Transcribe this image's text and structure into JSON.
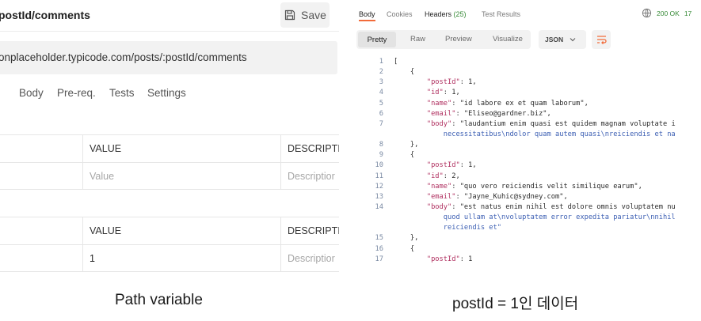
{
  "left_panel": {
    "request_title": "postId/comments",
    "save_label": "Save",
    "url": "onplaceholder.typicode.com/posts/:postId/comments",
    "tabs": [
      ")",
      "Body",
      "Pre-req.",
      "Tests",
      "Settings"
    ],
    "query_params_table": {
      "headers": [
        "",
        "VALUE",
        "DESCRIPTI"
      ],
      "rows": [
        [
          "",
          "Value",
          "Descriptior"
        ]
      ]
    },
    "path_variables_table": {
      "headers": [
        "",
        "VALUE",
        "DESCRIPTI"
      ],
      "rows": [
        [
          "",
          "1",
          "Descriptior"
        ]
      ]
    }
  },
  "right_panel": {
    "tabs": [
      "Body",
      "Cookies",
      "Headers",
      "Test Results"
    ],
    "headers_count": "(25)",
    "status": "200 OK",
    "time": "17",
    "format_tabs": [
      "Pretty",
      "Raw",
      "Preview",
      "Visualize"
    ],
    "format_select": "JSON",
    "line_numbers": [
      "1",
      "2",
      "3",
      "4",
      "5",
      "6",
      "7",
      "",
      "8",
      "9",
      "10",
      "11",
      "12",
      "13",
      "14",
      "",
      "",
      "15",
      "16",
      "17"
    ],
    "code_lines": [
      "[",
      "    {",
      "        \"postId\": 1,",
      "        \"id\": 1,",
      "        \"name\": \"id labore ex et quam laborum\",",
      "        \"email\": \"Eliseo@gardner.biz\",",
      "        \"body\": \"laudantium enim quasi est quidem magnam voluptate i",
      "            necessitatibus\\ndolor quam autem quasi\\nreiciendis et na",
      "    },",
      "    {",
      "        \"postId\": 1,",
      "        \"id\": 2,",
      "        \"name\": \"quo vero reiciendis velit similique earum\",",
      "        \"email\": \"Jayne_Kuhic@sydney.com\",",
      "        \"body\": \"est natus enim nihil est dolore omnis voluptatem nu",
      "            quod ullam at\\nvoluptatem error expedita pariatur\\nnihil",
      "            reiciendis et\"",
      "    },",
      "    {",
      "        \"postId\": 1"
    ]
  },
  "captions": {
    "left": "Path variable",
    "right": "postId = 1인 데이터"
  },
  "colors": {
    "accent": "#f26b3a",
    "status_green": "#3a8c3a"
  }
}
